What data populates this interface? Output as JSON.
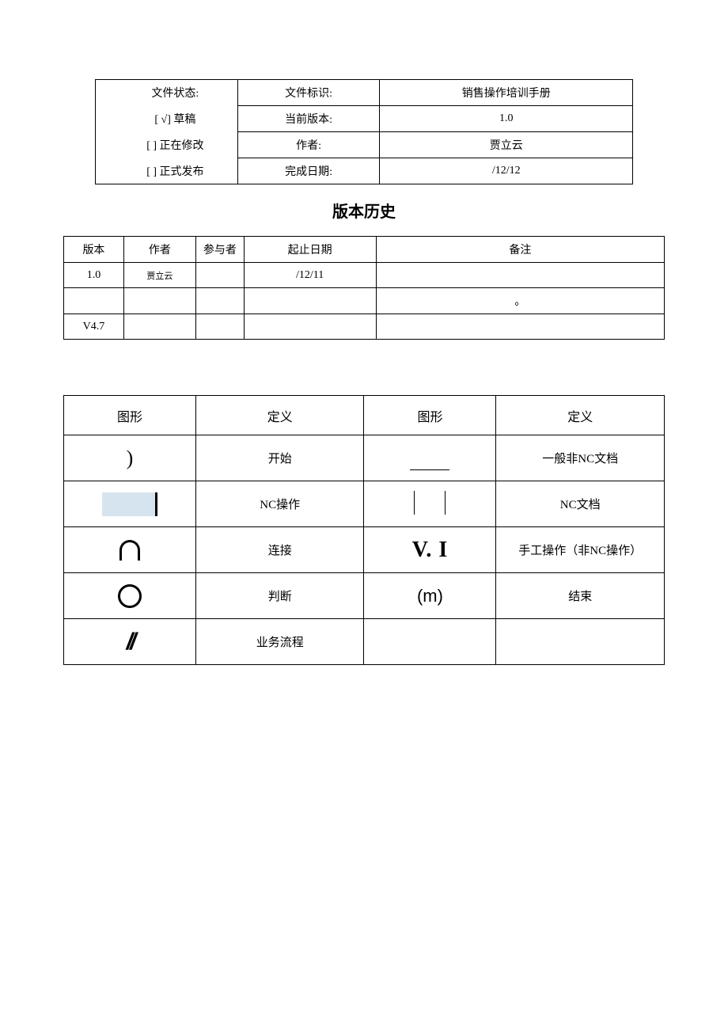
{
  "meta": {
    "status_label": "文件状态:",
    "status_draft": "[    √]  草稿",
    "status_modifying": "[      ]  正在修改",
    "status_published": "[      ]  正式发布",
    "file_id_label": "文件标识:",
    "file_id_value": "销售操作培训手册",
    "version_label": "当前版本:",
    "version_value": "1.0",
    "author_label": "作者:",
    "author_value": "贾立云",
    "date_label": "完成日期:",
    "date_value": "/12/12"
  },
  "history": {
    "title": "版本历史",
    "headers": {
      "version": "版本",
      "author": "作者",
      "participant": "参与者",
      "date": "起止日期",
      "remark": "备注"
    },
    "rows": [
      {
        "version": "1.0",
        "author": "贾立云",
        "participant": "",
        "date": "/12/11",
        "remark": ""
      },
      {
        "version": "",
        "author": "",
        "participant": "",
        "date": "",
        "remark": "。"
      },
      {
        "version": "V4.7",
        "author": "",
        "participant": "",
        "date": "",
        "remark": ""
      }
    ]
  },
  "symbols": {
    "headers": {
      "shape": "图形",
      "definition": "定义"
    },
    "rows": [
      {
        "def1": "开始",
        "def2": "一般非NC文档"
      },
      {
        "def1": "NC操作",
        "def2": "NC文档"
      },
      {
        "def1": "连接",
        "def2": "手工操作（非NC操作）"
      },
      {
        "def1": "判断",
        "def2": "结束"
      },
      {
        "def1": "业务流程",
        "def2": ""
      }
    ]
  }
}
